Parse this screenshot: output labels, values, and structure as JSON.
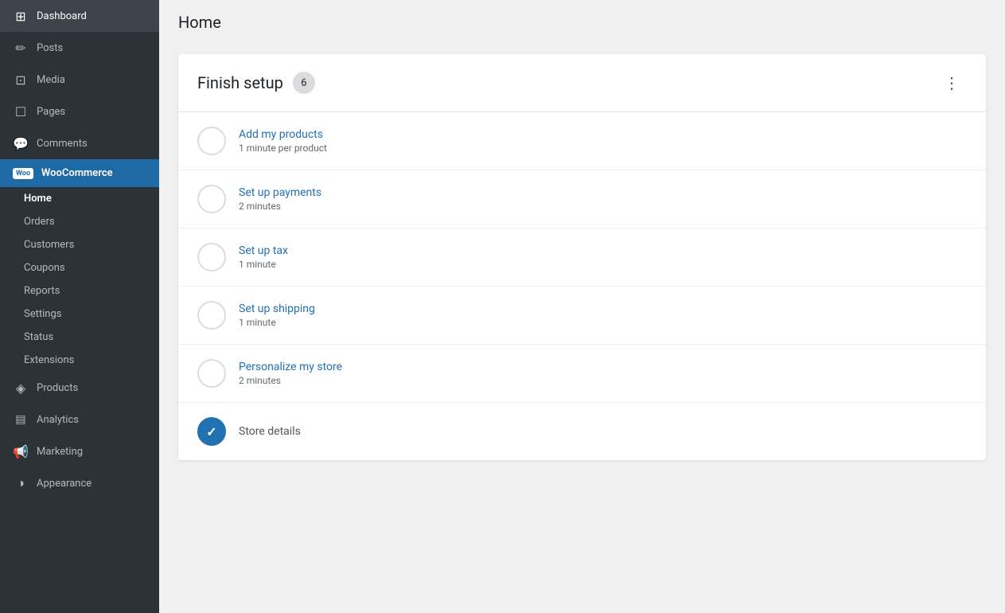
{
  "sidebar": {
    "items": [
      {
        "id": "dashboard",
        "label": "Dashboard",
        "icon": "⊞",
        "active": false
      },
      {
        "id": "posts",
        "label": "Posts",
        "icon": "✏",
        "active": false
      },
      {
        "id": "media",
        "label": "Media",
        "icon": "⊡",
        "active": false
      },
      {
        "id": "pages",
        "label": "Pages",
        "icon": "☐",
        "active": false
      },
      {
        "id": "comments",
        "label": "Comments",
        "icon": "💬",
        "active": false
      }
    ],
    "woocommerce": {
      "label": "WooCommerce",
      "badge": "Woo",
      "subnav": [
        {
          "id": "home",
          "label": "Home",
          "active": true
        },
        {
          "id": "orders",
          "label": "Orders",
          "active": false
        },
        {
          "id": "customers",
          "label": "Customers",
          "active": false
        },
        {
          "id": "coupons",
          "label": "Coupons",
          "active": false
        },
        {
          "id": "reports",
          "label": "Reports",
          "active": false
        },
        {
          "id": "settings",
          "label": "Settings",
          "active": false
        },
        {
          "id": "status",
          "label": "Status",
          "active": false
        },
        {
          "id": "extensions",
          "label": "Extensions",
          "active": false
        }
      ]
    },
    "bottom_items": [
      {
        "id": "products",
        "label": "Products",
        "icon": "◈",
        "active": false
      },
      {
        "id": "analytics",
        "label": "Analytics",
        "icon": "▤",
        "active": false
      },
      {
        "id": "marketing",
        "label": "Marketing",
        "icon": "📢",
        "active": false
      },
      {
        "id": "appearance",
        "label": "Appearance",
        "icon": "◑",
        "active": false
      }
    ]
  },
  "topbar": {
    "title": "Home"
  },
  "setup_card": {
    "title": "Finish setup",
    "badge": "6",
    "menu_icon": "⋮",
    "items": [
      {
        "id": "add-products",
        "title": "Add my products",
        "subtitle": "1 minute per product",
        "completed": false
      },
      {
        "id": "set-up-payments",
        "title": "Set up payments",
        "subtitle": "2 minutes",
        "completed": false
      },
      {
        "id": "set-up-tax",
        "title": "Set up tax",
        "subtitle": "1 minute",
        "completed": false
      },
      {
        "id": "set-up-shipping",
        "title": "Set up shipping",
        "subtitle": "1 minute",
        "completed": false
      },
      {
        "id": "personalize-store",
        "title": "Personalize my store",
        "subtitle": "2 minutes",
        "completed": false
      },
      {
        "id": "store-details",
        "title": "Store details",
        "subtitle": "",
        "completed": true
      }
    ]
  },
  "colors": {
    "sidebar_bg": "#2c3338",
    "sidebar_active": "#2271b1",
    "woo_blue": "#1d6aa5",
    "link_blue": "#2271b1",
    "completed_blue": "#2271b1"
  }
}
